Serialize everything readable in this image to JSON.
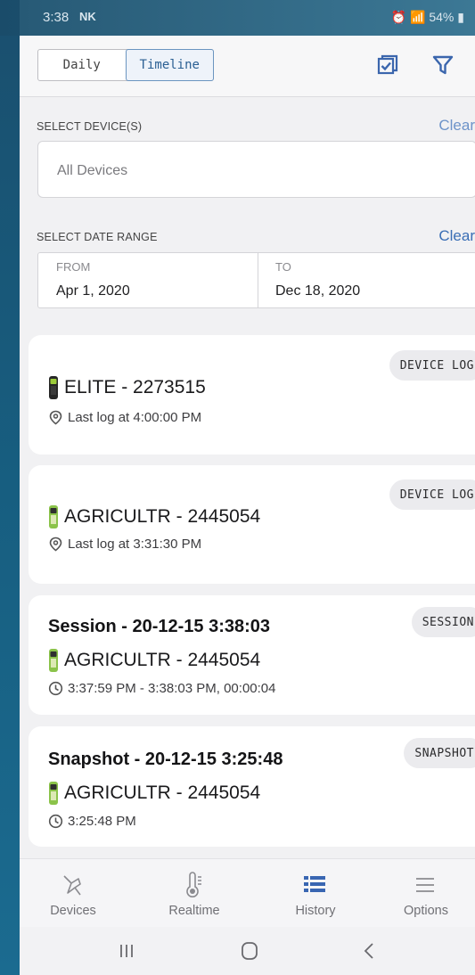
{
  "status_bar": {
    "time": "3:38",
    "carrier": "NK",
    "battery": "54%"
  },
  "header": {
    "tabs": [
      "Daily",
      "Timeline"
    ],
    "active_tab": "Timeline"
  },
  "devices": {
    "label": "SELECT DEVICE(S)",
    "clear": "Clear",
    "placeholder": "All Devices"
  },
  "date_range": {
    "label": "SELECT DATE RANGE",
    "clear": "Clear",
    "from_label": "FROM",
    "from_value": "Apr 1, 2020",
    "to_label": "TO",
    "to_value": "Dec 18, 2020"
  },
  "cards": [
    {
      "type": "device_log",
      "badge": "DEVICE LOG",
      "device": "ELITE - 2273515",
      "meta": "Last log at 4:00:00 PM"
    },
    {
      "type": "device_log",
      "badge": "DEVICE LOG",
      "device": "AGRICULTR - 2445054",
      "meta": "Last log at 3:31:30 PM"
    },
    {
      "type": "session",
      "badge": "SESSION",
      "title": "Session - 20-12-15 3:38:03",
      "device": "AGRICULTR - 2445054",
      "meta": "3:37:59 PM - 3:38:03 PM, 00:00:04"
    },
    {
      "type": "snapshot",
      "badge": "SNAPSHOT",
      "title": "Snapshot - 20-12-15 3:25:48",
      "device": "AGRICULTR - 2445054",
      "meta": "3:25:48 PM"
    }
  ],
  "nav": {
    "items": [
      "Devices",
      "Realtime",
      "History",
      "Options"
    ],
    "active": "History",
    "active_color": "#3966b2"
  }
}
